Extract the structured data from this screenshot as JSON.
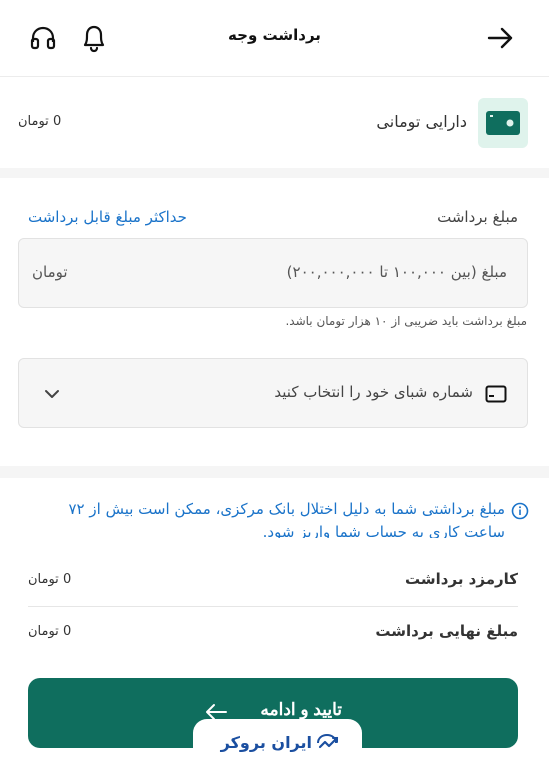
{
  "header": {
    "title": "برداشت وجه",
    "back_icon": "arrow-right-icon",
    "notification_icon": "bell-icon",
    "support_icon": "headphones-icon"
  },
  "balance": {
    "label": "دارایی تومانی",
    "value": "0 تومان",
    "icon": "wallet-icon"
  },
  "form": {
    "amount_label": "مبلغ برداشت",
    "max_link": "حداکثر مبلغ قابل برداشت",
    "amount_placeholder": "مبلغ (بین ۱۰۰,۰۰۰ تا ۲۰۰,۰۰۰,۰۰۰)",
    "amount_unit": "تومان",
    "hint": "مبلغ برداشت باید ضریبی از ۱۰ هزار تومان باشد.",
    "sheba_placeholder": "شماره شبای خود را انتخاب کنید"
  },
  "notice": {
    "text": "مبلغ برداشتی شما به دلیل اختلال بانک مرکزی، ممکن است بیش از ۷۲ ساعت کاری به حساب شما واریز شود."
  },
  "summary": {
    "fee_label": "کارمزد برداشت",
    "fee_value": "0 تومان",
    "final_label": "مبلغ نهایی برداشت",
    "final_value": "0 تومان"
  },
  "actions": {
    "confirm_label": "تایید و ادامه"
  },
  "brand": {
    "name": "ایران بروکر"
  },
  "colors": {
    "primary": "#0f6e5e",
    "link": "#1a73c9",
    "wallet_bg": "#dff3ec",
    "brand": "#1b4fa0"
  }
}
